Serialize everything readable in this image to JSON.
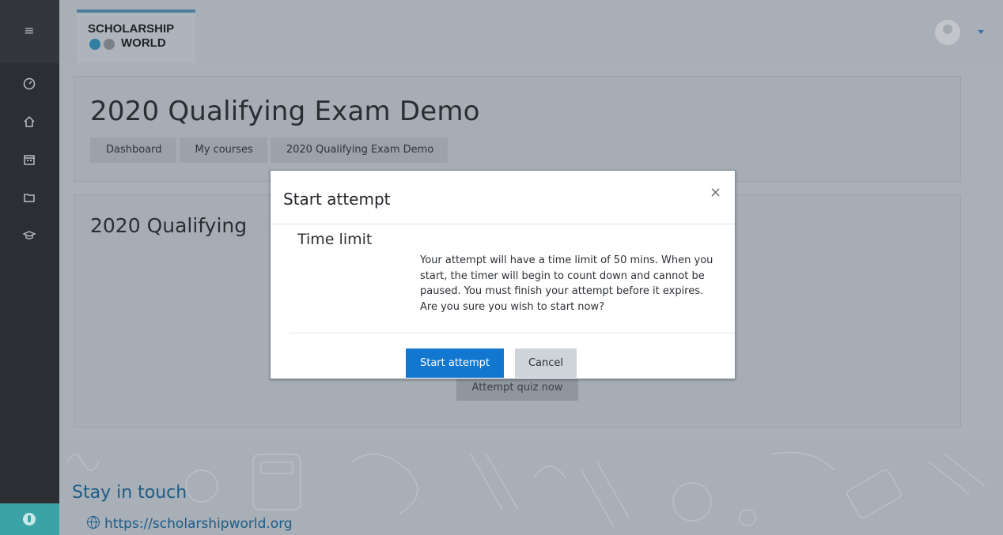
{
  "header": {
    "logo_line1": "SCHOLARSHIP",
    "logo_line2": "WORLD",
    "logo_colors": [
      "#2f7fa4",
      "#7a8087"
    ]
  },
  "sidebar": {
    "items": [
      {
        "name": "dashboard",
        "icon": "speedometer-icon"
      },
      {
        "name": "home",
        "icon": "home-icon"
      },
      {
        "name": "calendar",
        "icon": "calendar-icon"
      },
      {
        "name": "files",
        "icon": "folder-icon"
      },
      {
        "name": "courses",
        "icon": "graduation-cap-icon"
      }
    ],
    "accessibility_icon": "accessibility-icon"
  },
  "page": {
    "title": "2020 Qualifying Exam Demo",
    "breadcrumbs": [
      "Dashboard",
      "My courses",
      "2020 Qualifying Exam Demo"
    ],
    "section_title": "2020 Qualifying",
    "attempt_button": "Attempt quiz now"
  },
  "footer": {
    "stay_in_touch": "Stay in touch",
    "url": "https://scholarshipworld.org"
  },
  "modal": {
    "title": "Start attempt",
    "close_symbol": "×",
    "time_limit_label": "Time limit",
    "time_limit_text": "Your attempt will have a time limit of 50 mins. When you start, the timer will begin to count down and cannot be paused. You must finish your attempt before it expires. Are you sure you wish to start now?",
    "start_button": "Start attempt",
    "cancel_button": "Cancel",
    "accent_color": "#1177d1"
  }
}
